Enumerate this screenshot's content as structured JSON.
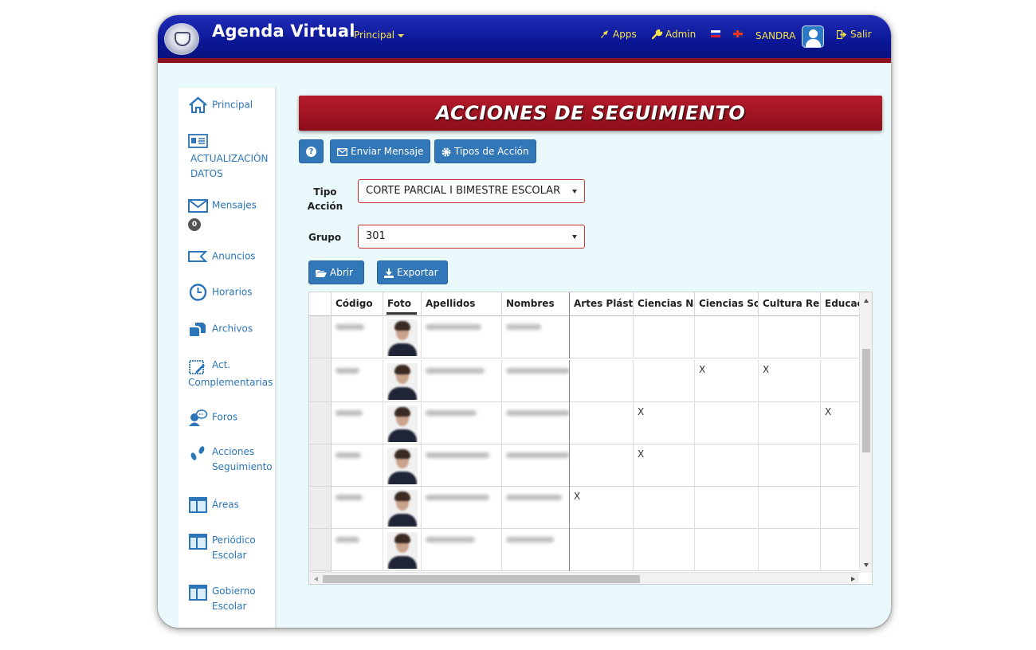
{
  "header": {
    "brand": "Agenda Virtual",
    "principal_menu": "Principal",
    "apps": "Apps",
    "admin": "Admin",
    "user": "SANDRA",
    "logout": "Salir"
  },
  "sidebar": {
    "items": [
      {
        "label": "Principal",
        "icon": "home-icon"
      },
      {
        "label": "ACTUALIZACIÓN DATOS",
        "icon": "id-card-icon"
      },
      {
        "label": "Mensajes",
        "icon": "envelope-icon",
        "badge": "0"
      },
      {
        "label": "Anuncios",
        "icon": "megaphone-icon"
      },
      {
        "label": "Horarios",
        "icon": "clock-icon"
      },
      {
        "label": "Archivos",
        "icon": "files-icon"
      },
      {
        "label": "Act. Complementarias",
        "icon": "calendar-edit-icon"
      },
      {
        "label": "Foros",
        "icon": "chat-user-icon"
      },
      {
        "label": "Acciones Seguimiento",
        "icon": "footprints-icon"
      },
      {
        "label": "Áreas",
        "icon": "layout-icon"
      },
      {
        "label": "Periódico Escolar",
        "icon": "newspaper-icon"
      },
      {
        "label": "Gobierno Escolar",
        "icon": "layout-icon"
      }
    ]
  },
  "main": {
    "title": "ACCIONES DE SEGUIMIENTO",
    "help_button": "?",
    "send_message_button": "Enviar Mensaje",
    "action_types_button": "Tipos de Acción",
    "tipo_accion_label": "Tipo Acción",
    "tipo_accion_value": "CORTE PARCIAL I BIMESTRE ESCOLAR",
    "grupo_label": "Grupo",
    "grupo_value": "301",
    "open_button": "Abrir",
    "export_button": "Exportar"
  },
  "table": {
    "columns": [
      "Código",
      "Foto",
      "Apellidos",
      "Nombres",
      "Artes Plásticas",
      "Ciencias Naturales",
      "Ciencias Sociales",
      "Cultura Religiosa",
      "Educación"
    ],
    "rows": [
      {
        "marks": [
          "",
          "",
          "",
          "",
          ""
        ]
      },
      {
        "marks": [
          "",
          "",
          "X",
          "X",
          ""
        ]
      },
      {
        "marks": [
          "",
          "X",
          "",
          "",
          "X"
        ]
      },
      {
        "marks": [
          "",
          "X",
          "",
          "",
          ""
        ]
      },
      {
        "marks": [
          "X",
          "",
          "",
          "",
          ""
        ]
      },
      {
        "marks": [
          "",
          "",
          "",
          "",
          ""
        ]
      }
    ]
  },
  "colors": {
    "navbar": "#0b1796",
    "navbar_border": "#8c1221",
    "nav_text": "#f5e24a",
    "title_bar": "#a0121f",
    "button": "#3277b7",
    "sidebar_link": "#2b75b8",
    "page_bg": "#eaf9fb"
  }
}
